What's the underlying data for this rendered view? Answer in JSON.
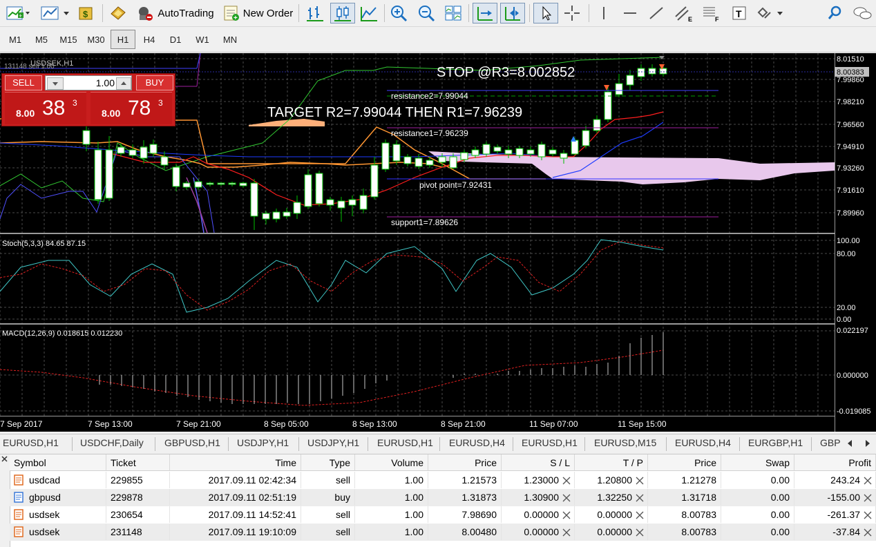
{
  "toolbar": {
    "autotrading_label": "AutoTrading",
    "new_order_label": "New Order"
  },
  "timeframes": [
    "M1",
    "M5",
    "M15",
    "M30",
    "H1",
    "H4",
    "D1",
    "W1",
    "MN"
  ],
  "active_timeframe": "H1",
  "chart": {
    "symbol_title": "USDSEK,H1",
    "title_overlay": "131148 sell 1.00",
    "current_price": "8.00383",
    "price_axis": [
      "8.01510",
      "7.99860",
      "7.98210",
      "7.96560",
      "7.94910",
      "7.93260",
      "7.91610",
      "7.89960"
    ],
    "time_axis": [
      "7 Sep 2017",
      "7 Sep 13:00",
      "7 Sep 21:00",
      "8 Sep 05:00",
      "8 Sep 13:00",
      "8 Sep 21:00",
      "11 Sep 07:00",
      "11 Sep 15:00"
    ],
    "annotations": {
      "stop": "STOP @R3=8.002852",
      "target": "TARGET R2=7.99044 THEN R1=7.96239",
      "resistance2": "resistance2=7.99044",
      "resistance1": "resistance1=7.96239",
      "pivot": "pivot point=7.92431",
      "support1": "support1=7.89626"
    },
    "stoch": {
      "label": "Stoch(5,3,3) 84.65 87.15",
      "axis": [
        "100.00",
        "80.00",
        "20.00",
        "0.00"
      ]
    },
    "macd": {
      "label": "MACD(12,26,9) 0.018615 0.012230",
      "axis": [
        "0.022197",
        "0.000000",
        "-0.019085"
      ]
    },
    "colors": {
      "background": "#000000",
      "grid": "#4a4a4a",
      "bull_candle": "#ffffff",
      "candle_wick": "#00c000",
      "tenkan": "#ff1e1e",
      "kijun": "#1e3cff",
      "chikou": "#32c832",
      "senkou_a": "#ff9632",
      "senkou_b": "#d0a0d8",
      "cloud_up": "#ffb07a",
      "cloud_down": "#e8c8ec",
      "stoch_main": "#40c8c8",
      "stoch_signal": "#e02020",
      "macd_hist": "#c8c8c8",
      "macd_signal": "#e02020"
    }
  },
  "one_click": {
    "sell_label": "SELL",
    "buy_label": "BUY",
    "lot": "1.00",
    "sell_price_prefix": "8.00",
    "sell_price_big": "38",
    "sell_price_sup": "3",
    "buy_price_prefix": "8.00",
    "buy_price_big": "78",
    "buy_price_sup": "3"
  },
  "symbol_tabs": [
    "EURUSD,H1",
    "USDCHF,Daily",
    "GBPUSD,H1",
    "USDJPY,H1",
    "USDJPY,H1",
    "EURUSD,H1",
    "EURUSD,H4",
    "EURUSD,H1",
    "EURUSD,M15",
    "EURUSD,H4",
    "EURGBP,H1",
    "GBP"
  ],
  "terminal": {
    "columns": [
      "Symbol",
      "Ticket",
      "Time",
      "Type",
      "Volume",
      "Price",
      "S / L",
      "T / P",
      "Price",
      "Swap",
      "Profit"
    ],
    "rows": [
      {
        "symbol": "usdcad",
        "ticket": "229855",
        "time": "2017.09.11 02:42:34",
        "type": "sell",
        "volume": "1.00",
        "price": "1.21573",
        "sl": "1.23000",
        "tp": "1.20800",
        "cur": "1.21278",
        "swap": "0.00",
        "profit": "243.24"
      },
      {
        "symbol": "gbpusd",
        "ticket": "229878",
        "time": "2017.09.11 02:51:19",
        "type": "buy",
        "volume": "1.00",
        "price": "1.31873",
        "sl": "1.30900",
        "tp": "1.32250",
        "cur": "1.31718",
        "swap": "0.00",
        "profit": "-155.00"
      },
      {
        "symbol": "usdsek",
        "ticket": "230654",
        "time": "2017.09.11 14:52:41",
        "type": "sell",
        "volume": "1.00",
        "price": "7.98690",
        "sl": "0.00000",
        "tp": "0.00000",
        "cur": "8.00783",
        "swap": "0.00",
        "profit": "-261.37"
      },
      {
        "symbol": "usdsek",
        "ticket": "231148",
        "time": "2017.09.11 19:10:09",
        "type": "sell",
        "volume": "1.00",
        "price": "8.00480",
        "sl": "0.00000",
        "tp": "0.00000",
        "cur": "8.00783",
        "swap": "0.00",
        "profit": "-37.84"
      }
    ]
  }
}
